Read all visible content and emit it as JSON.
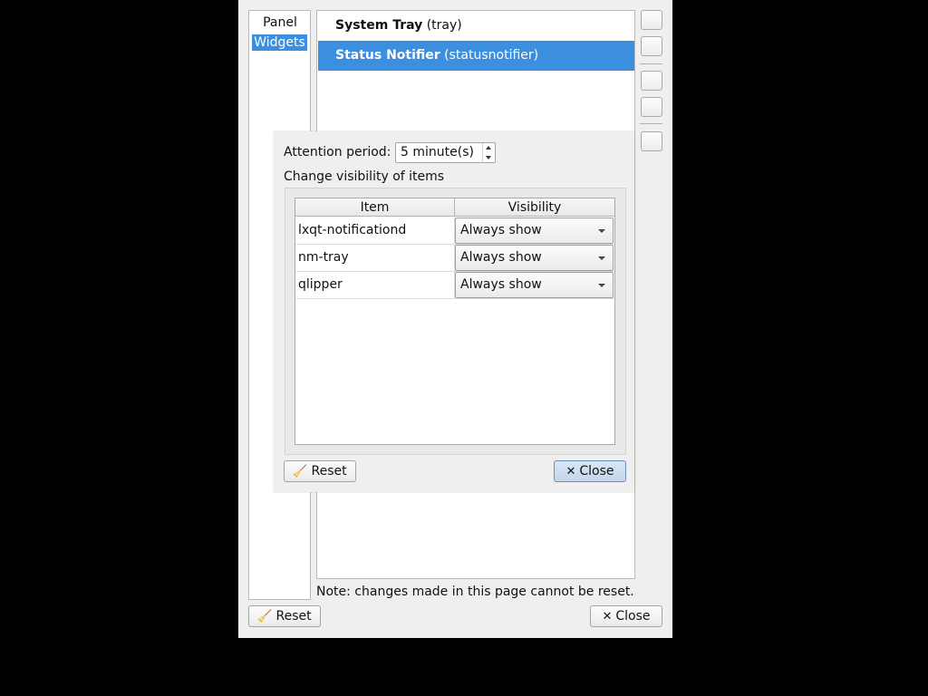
{
  "sidebar": {
    "items": [
      {
        "label": "Panel",
        "selected": false
      },
      {
        "label": "Widgets",
        "selected": true
      }
    ]
  },
  "plugins": [
    {
      "name": "System Tray",
      "id": "(tray)",
      "selected": false
    },
    {
      "name": "Status Notifier",
      "id": "(statusnotifier)",
      "selected": true
    }
  ],
  "note": "Note: changes made in this page cannot be reset.",
  "main_buttons": {
    "reset": "Reset",
    "close": "Close"
  },
  "dialog": {
    "attention_label": "Attention period:",
    "attention_value": "5 minute(s)",
    "visibility_label": "Change visibility of items",
    "table": {
      "headers": [
        "Item",
        "Visibility"
      ],
      "rows": [
        {
          "item": "lxqt-notificationd",
          "visibility": "Always show"
        },
        {
          "item": "nm-tray",
          "visibility": "Always show"
        },
        {
          "item": "qlipper",
          "visibility": "Always show"
        }
      ]
    },
    "buttons": {
      "reset": "Reset",
      "close": "Close"
    }
  },
  "icons": {
    "reset": "broom-icon",
    "close": "close-x-icon"
  },
  "colors": {
    "selection": "#3c8fde",
    "window_bg": "#efefef",
    "desktop_bg": "#000000"
  }
}
